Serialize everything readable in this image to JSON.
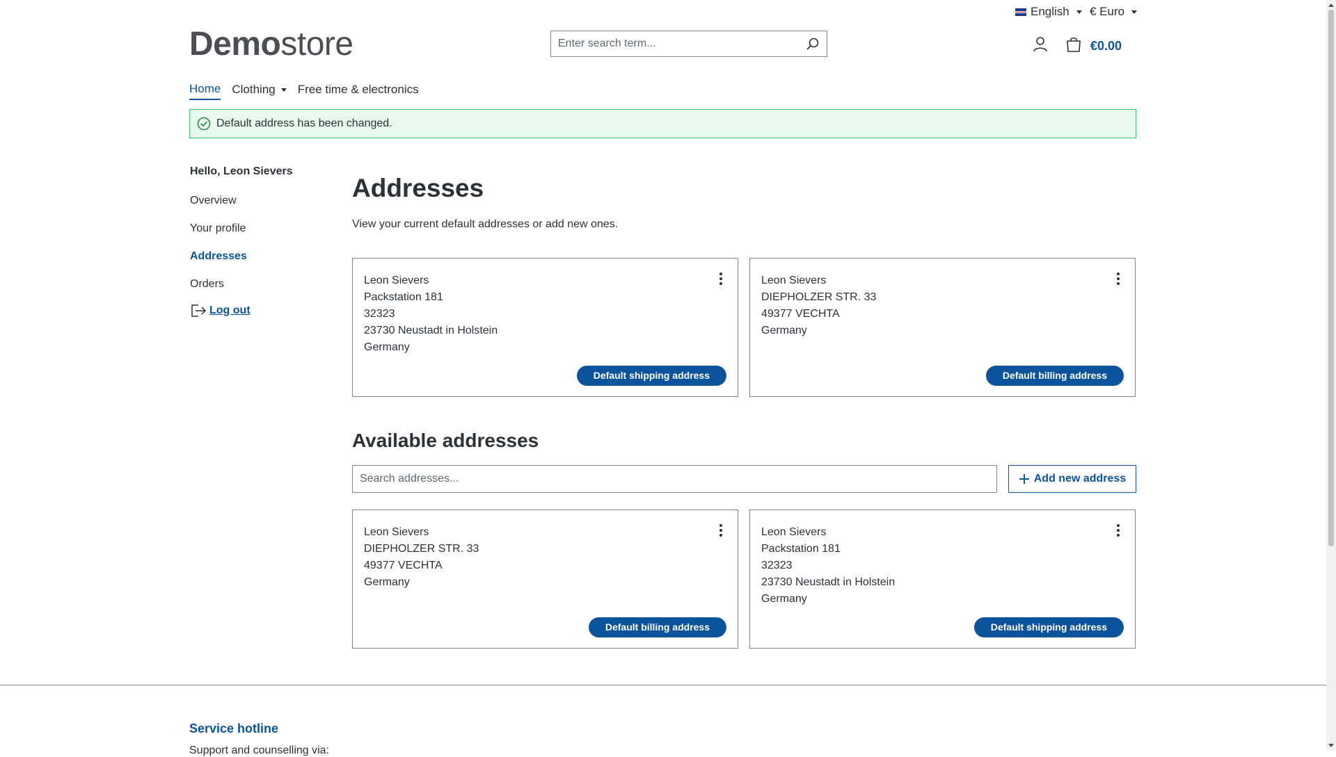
{
  "header": {
    "language": "English",
    "currency": "€ Euro",
    "logo_bold": "Demo",
    "logo_light": "store",
    "search_placeholder": "Enter search term...",
    "cart_total": "€0.00"
  },
  "nav": {
    "items": [
      "Home",
      "Clothing",
      "Free time & electronics"
    ]
  },
  "alert": {
    "message": "Default address has been changed."
  },
  "sidebar": {
    "greeting": "Hello, Leon Sievers",
    "links": [
      "Overview",
      "Your profile",
      "Addresses",
      "Orders"
    ],
    "logout": "Log out"
  },
  "main": {
    "title": "Addresses",
    "intro": "View your current default addresses or add new ones.",
    "available_title": "Available addresses",
    "search_placeholder": "Search addresses...",
    "add_button": "Add new address"
  },
  "default_addresses": [
    {
      "lines": [
        "Leon Sievers",
        "Packstation 181",
        "32323",
        "23730 Neustadt in Holstein",
        "Germany"
      ],
      "badge": "Default shipping address"
    },
    {
      "lines": [
        "Leon Sievers",
        "DIEPHOLZER STR. 33",
        "49377 VECHTA",
        "Germany",
        ""
      ],
      "badge": "Default billing address"
    }
  ],
  "available_addresses": [
    {
      "lines": [
        "Leon Sievers",
        "DIEPHOLZER STR. 33",
        "49377 VECHTA",
        "Germany",
        ""
      ],
      "badge": "Default billing address"
    },
    {
      "lines": [
        "Leon Sievers",
        "Packstation 181",
        "32323",
        "23730 Neustadt in Holstein",
        "Germany"
      ],
      "badge": "Default shipping address"
    }
  ],
  "footer": {
    "hotline_title": "Service hotline",
    "support_text": "Support and counselling via:"
  },
  "colors": {
    "primary": "#0b539b",
    "alert_border": "#3cc261",
    "alert_bg": "#e6f9ec"
  }
}
